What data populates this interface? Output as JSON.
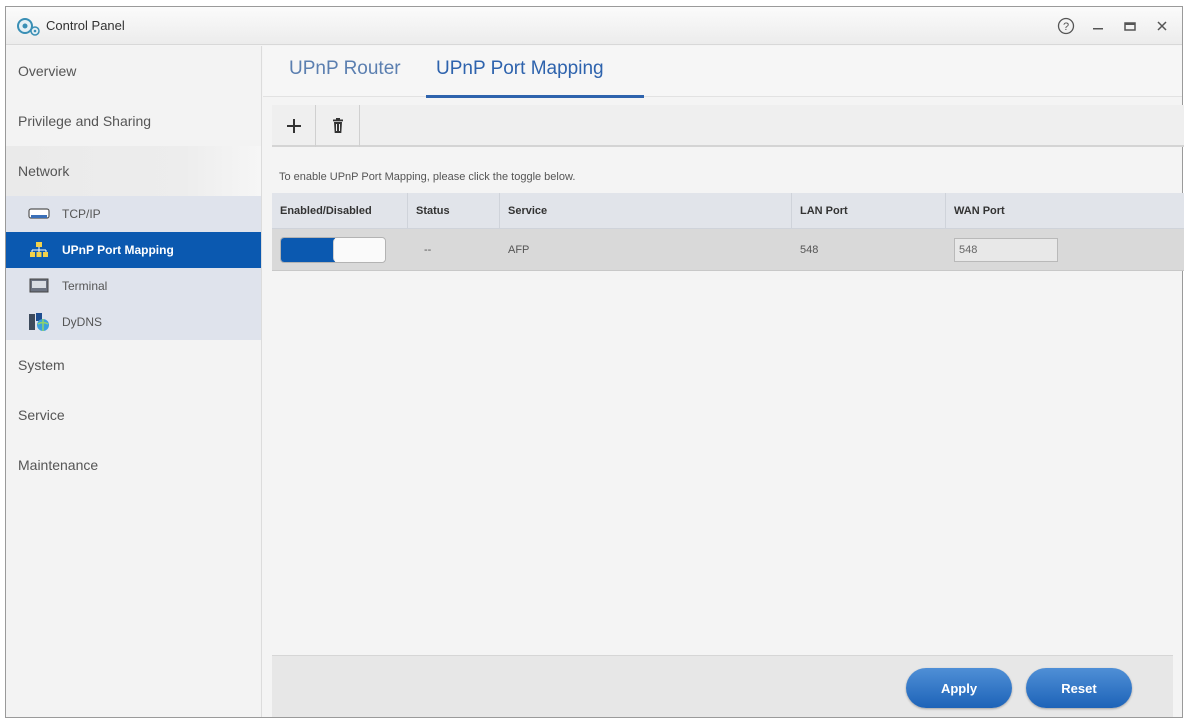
{
  "window": {
    "title": "Control Panel",
    "controls": {
      "help": "?",
      "minimize": "–",
      "maximize": "▭",
      "close": "✕"
    }
  },
  "sidebar": {
    "categories": {
      "overview": "Overview",
      "privilege": "Privilege and Sharing",
      "network": "Network",
      "system": "System",
      "service": "Service",
      "maintenance": "Maintenance"
    },
    "network_items": [
      {
        "label": "TCP/IP",
        "icon": "ethernet-icon"
      },
      {
        "label": "UPnP Port Mapping",
        "icon": "upnp-network-icon",
        "selected": true
      },
      {
        "label": "Terminal",
        "icon": "terminal-icon"
      },
      {
        "label": "DyDNS",
        "icon": "dydns-globe-icon"
      }
    ]
  },
  "tabs": [
    {
      "label": "UPnP Router",
      "active": false
    },
    {
      "label": "UPnP Port Mapping",
      "active": true
    }
  ],
  "toolbar": {
    "add_icon": "plus-icon",
    "delete_icon": "trash-icon"
  },
  "hint": "To enable UPnP Port Mapping, please click the toggle below.",
  "table": {
    "headers": [
      "Enabled/Disabled",
      "Status",
      "Service",
      "LAN Port",
      "WAN Port"
    ],
    "rows": [
      {
        "enabled": true,
        "status": "--",
        "service": "AFP",
        "lan_port": "548",
        "wan_port": "548"
      }
    ]
  },
  "footer": {
    "apply": "Apply",
    "reset": "Reset"
  },
  "colors": {
    "accent": "#0b59b0",
    "tab_active": "#2e63ad"
  }
}
